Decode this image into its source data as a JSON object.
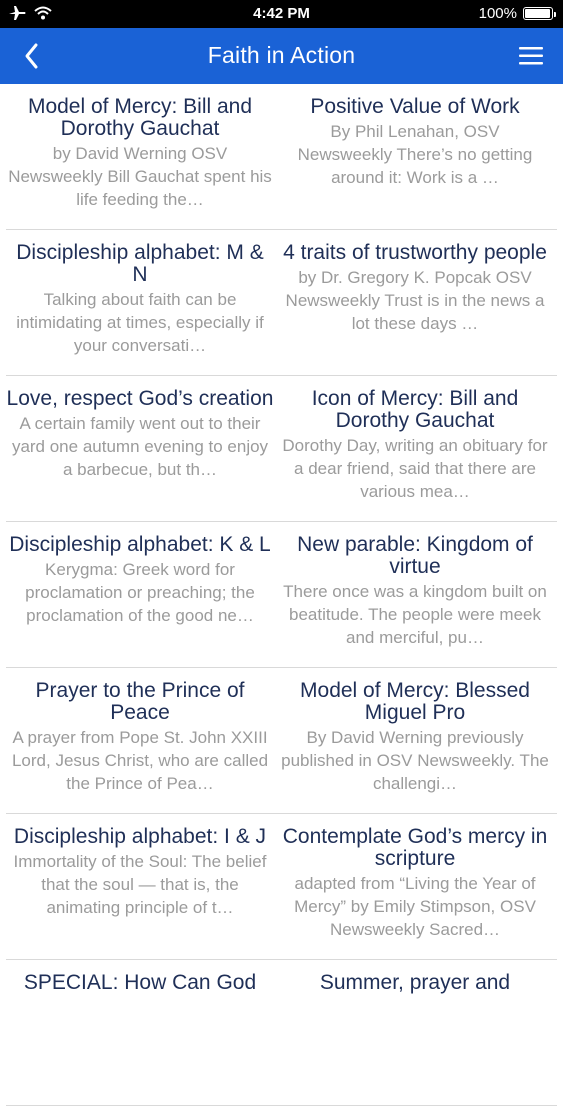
{
  "status_bar": {
    "time": "4:42 PM",
    "battery": "100%",
    "icons": [
      "airplane-mode-icon",
      "wifi-icon",
      "battery-icon"
    ]
  },
  "nav": {
    "title": "Faith in Action",
    "back_icon": "chevron-left-icon",
    "menu_icon": "hamburger-menu-icon",
    "color": "#1a62d6"
  },
  "articles": [
    {
      "title": "Model of Mercy: Bill and Dorothy Gauchat",
      "summary": "by David Werning OSV Newsweekly Bill Gauchat spent his life feeding the…"
    },
    {
      "title": "Positive Value of Work",
      "summary": "By Phil Lenahan, OSV Newsweekly There’s no getting around it: Work is a …"
    },
    {
      "title": "Discipleship alphabet: M & N",
      "summary": "Talking about faith can be intimidating at times, especially if your conversati…"
    },
    {
      "title": "4 traits of trustworthy people",
      "summary": "by Dr. Gregory K. Popcak OSV Newsweekly Trust is in the news a lot these days …"
    },
    {
      "title": "Love, respect God’s creation",
      "summary": "A certain family went out to their yard one autumn evening to enjoy a barbecue, but th…"
    },
    {
      "title": "Icon of Mercy: Bill and Dorothy Gauchat",
      "summary": "Dorothy Day, writing an obituary for a dear friend, said that there are various mea…"
    },
    {
      "title": "Discipleship alphabet: K & L",
      "summary": "Kerygma: Greek word for proclamation or preaching; the proclamation of the good ne…"
    },
    {
      "title": "New parable: Kingdom of virtue",
      "summary": "There once was a kingdom built on beatitude. The people were meek and merciful, pu…"
    },
    {
      "title": "Prayer to the Prince of Peace",
      "summary": "A prayer from Pope St. John XXIII Lord, Jesus Christ, who are called the Prince of Pea…"
    },
    {
      "title": "Model of Mercy: Blessed Miguel Pro",
      "summary": "By David Werning previously published in OSV Newsweekly. The challengi…"
    },
    {
      "title": "Discipleship alphabet: I & J",
      "summary": "Immortality of the Soul: The belief that the soul — that is, the animating principle of t…"
    },
    {
      "title": "Contemplate God’s mercy in scripture",
      "summary": "adapted from “Living the Year of Mercy” by Emily Stimpson, OSV Newsweekly Sacred…"
    },
    {
      "title": "SPECIAL: How Can God",
      "summary": ""
    },
    {
      "title": "Summer, prayer and",
      "summary": ""
    }
  ]
}
